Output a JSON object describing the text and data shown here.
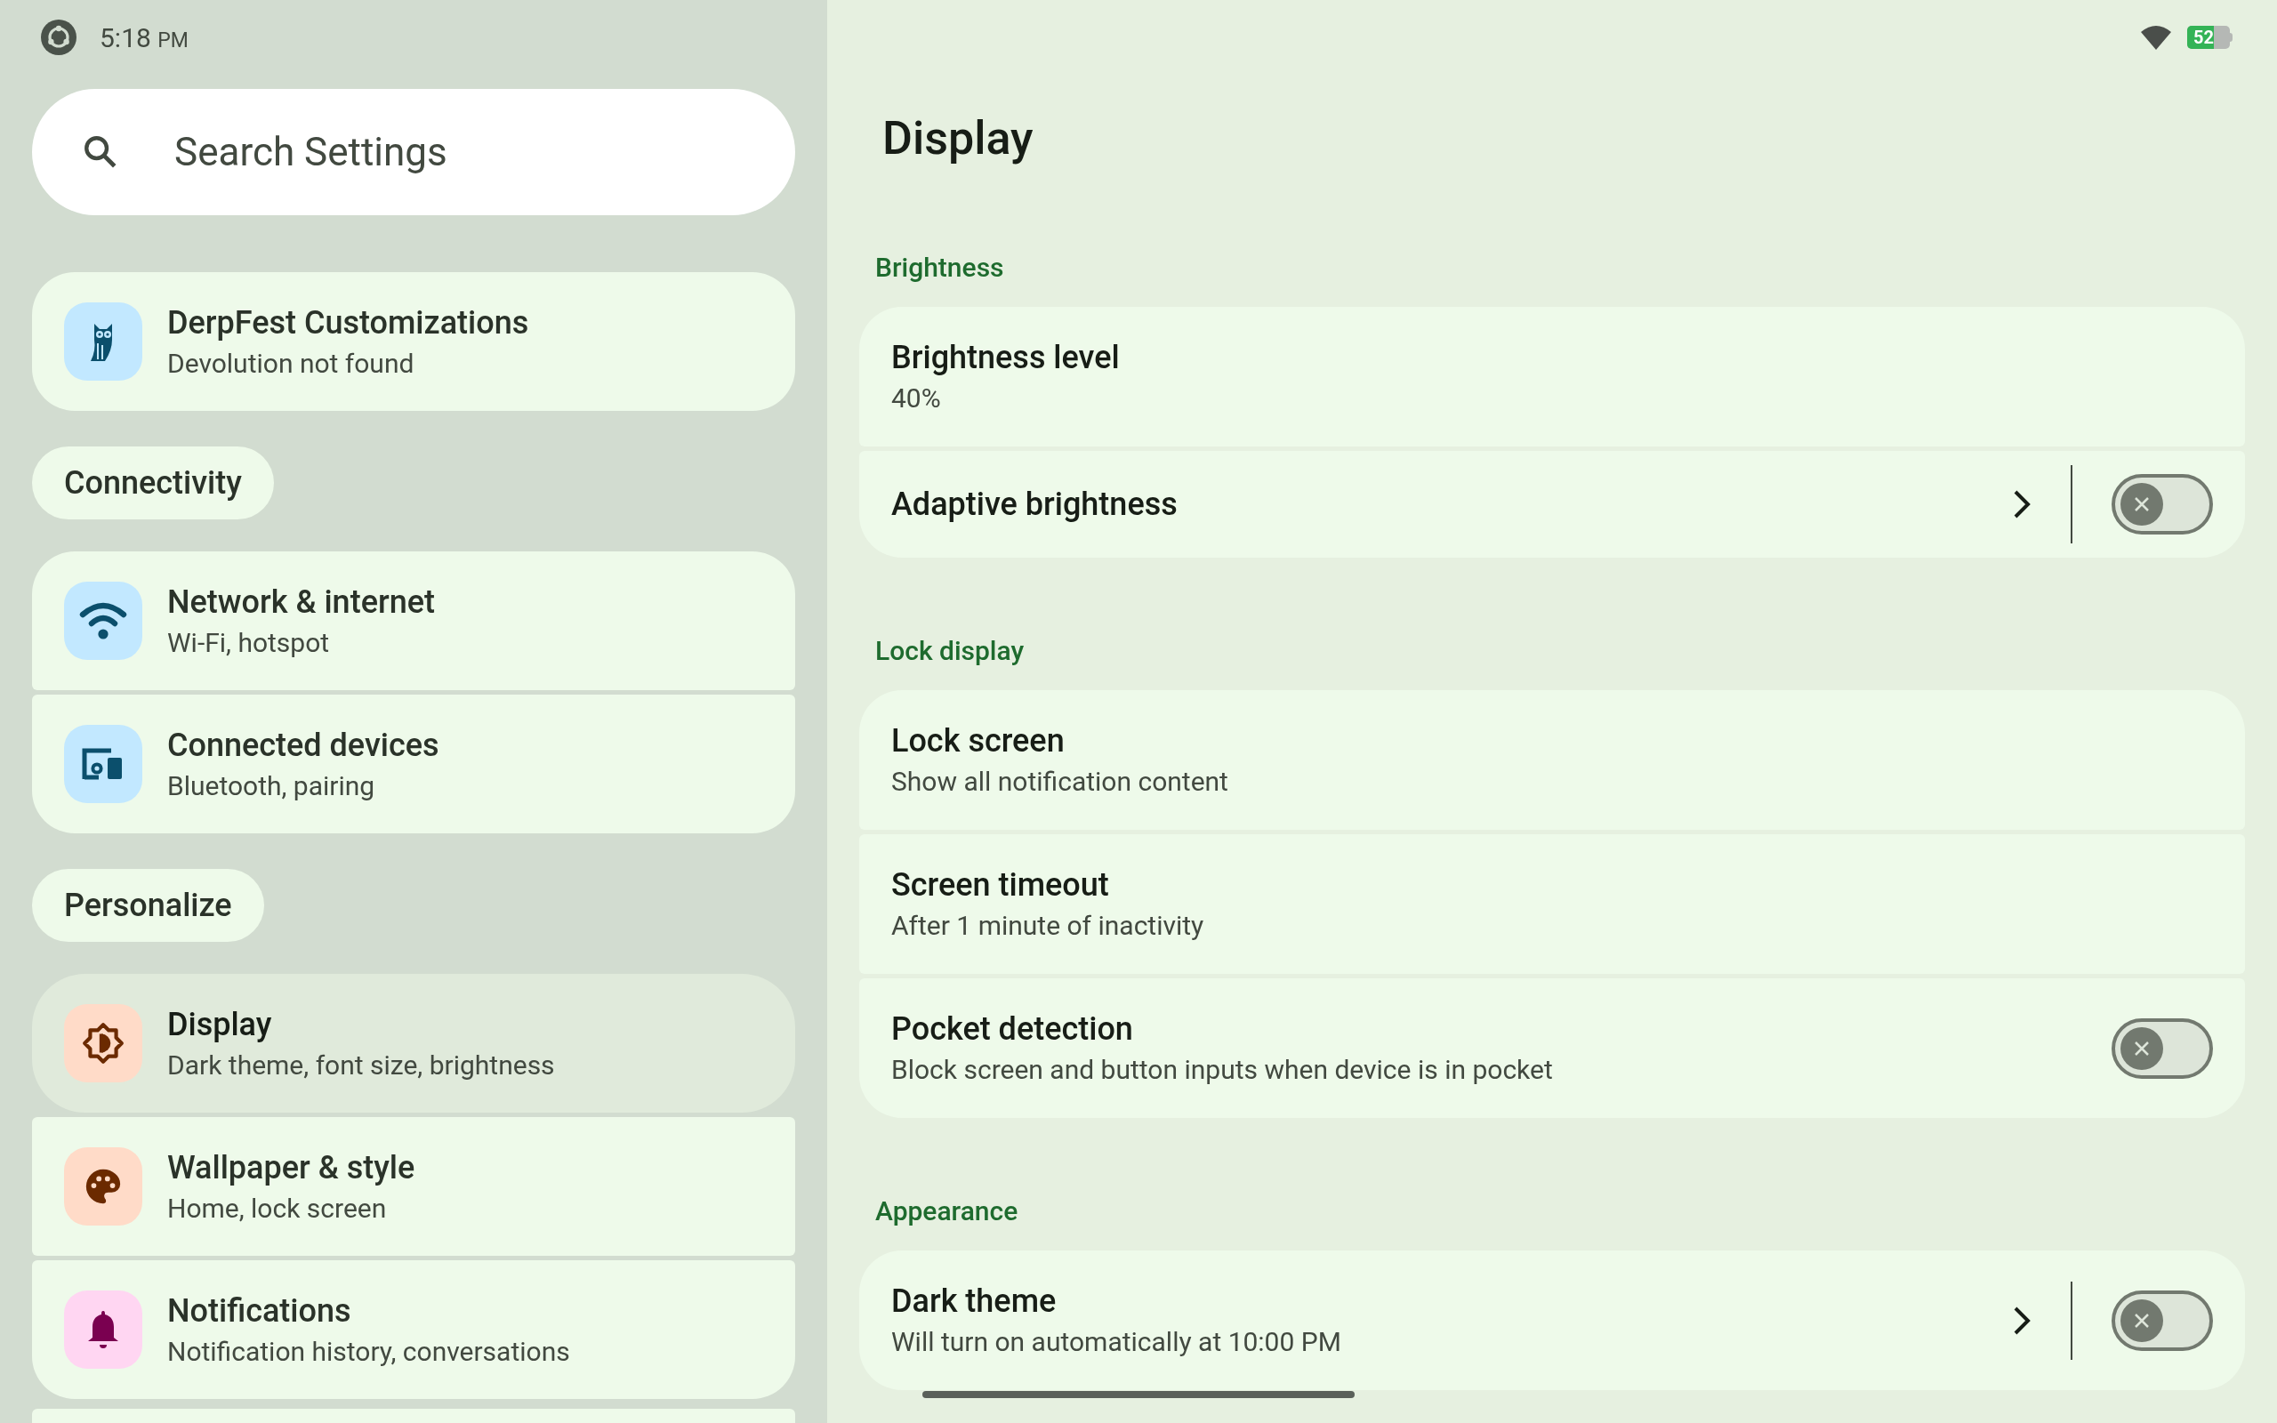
{
  "status_bar": {
    "time": "5:18",
    "time_suffix": "PM",
    "battery": "52"
  },
  "search": {
    "placeholder": "Search Settings"
  },
  "sidebar": {
    "sections": [
      {
        "items": [
          {
            "title": "DerpFest Customizations",
            "subtitle": "Devolution not found",
            "selected": false,
            "color": "#c2e8ff"
          }
        ]
      },
      {
        "header": "Connectivity",
        "items": [
          {
            "title": "Network & internet",
            "subtitle": "Wi-Fi, hotspot",
            "selected": false,
            "color": "#c2e8ff"
          },
          {
            "title": "Connected devices",
            "subtitle": "Bluetooth, pairing",
            "selected": false,
            "color": "#c2e8ff"
          }
        ]
      },
      {
        "header": "Personalize",
        "items": [
          {
            "title": "Display",
            "subtitle": "Dark theme, font size, brightness",
            "selected": true,
            "color": "#ffdbc8"
          },
          {
            "title": "Wallpaper & style",
            "subtitle": "Home, lock screen",
            "selected": false,
            "color": "#ffdbc8"
          },
          {
            "title": "Notifications",
            "subtitle": "Notification history, conversations",
            "selected": false,
            "color": "#ffd6f2"
          }
        ]
      }
    ]
  },
  "page": {
    "title": "Display",
    "sections": [
      {
        "header": "Brightness",
        "rows": [
          {
            "kind": "plain",
            "title": "Brightness level",
            "subtitle": "40%"
          },
          {
            "kind": "switch_link",
            "title": "Adaptive brightness",
            "on": false
          }
        ]
      },
      {
        "header": "Lock display",
        "rows": [
          {
            "kind": "plain",
            "title": "Lock screen",
            "subtitle": "Show all notification content"
          },
          {
            "kind": "plain",
            "title": "Screen timeout",
            "subtitle": "After 1 minute of inactivity"
          },
          {
            "kind": "switch",
            "title": "Pocket detection",
            "subtitle": "Block screen and button inputs when device is in pocket",
            "on": false
          }
        ]
      },
      {
        "header": "Appearance",
        "rows": [
          {
            "kind": "switch_link",
            "title": "Dark theme",
            "subtitle": "Will turn on automatically at 10:00 PM",
            "on": false
          }
        ]
      }
    ]
  }
}
